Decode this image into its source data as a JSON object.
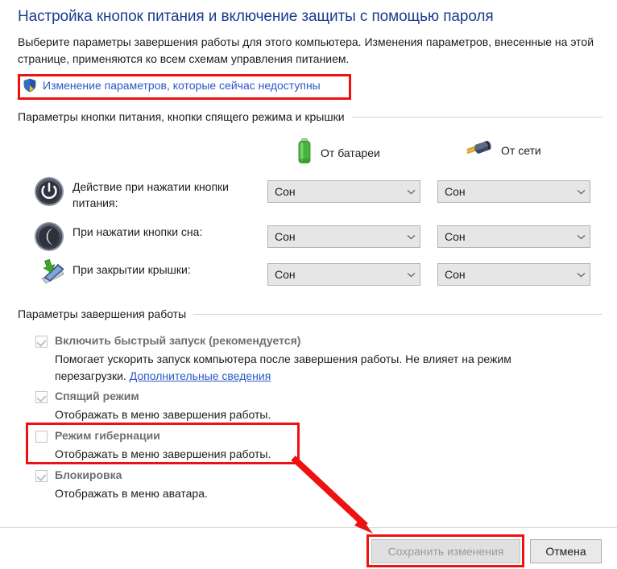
{
  "page": {
    "title": "Настройка кнопок питания и включение защиты с помощью пароля",
    "intro": "Выберите параметры завершения работы для этого компьютера. Изменения параметров, внесенные на этой странице, применяются ко всем схемам управления питанием.",
    "uac_link": "Изменение параметров, которые сейчас недоступны",
    "uac_icon": "shield-icon"
  },
  "colors": {
    "title": "#1b3d8f",
    "link": "#2a58c8",
    "annotation": "#ee1111",
    "combo_bg": "#e6e6e6",
    "battery_green": "#45b43a",
    "disabled_text": "#9a9a9a"
  },
  "power_section": {
    "header": "Параметры кнопки питания, кнопки спящего режима и крышки",
    "columns": [
      {
        "label": "От батареи",
        "icon": "battery-icon"
      },
      {
        "label": "От сети",
        "icon": "power-plug-icon"
      }
    ],
    "rows": [
      {
        "icon": "power-button-icon",
        "label": "Действие при нажатии кнопки питания:",
        "battery_value": "Сон",
        "mains_value": "Сон"
      },
      {
        "icon": "sleep-moon-icon",
        "label": "При нажатии кнопки сна:",
        "battery_value": "Сон",
        "mains_value": "Сон"
      },
      {
        "icon": "laptop-lid-icon",
        "label": "При закрытии крышки:",
        "battery_value": "Сон",
        "mains_value": "Сон"
      }
    ]
  },
  "shutdown_section": {
    "header": "Параметры завершения работы",
    "options": [
      {
        "label": "Включить быстрый запуск (рекомендуется)",
        "checked": true,
        "enabled": false,
        "description": "Помогает ускорить запуск компьютера после завершения работы. Не влияет на режим перезагрузки. ",
        "link": "Дополнительные сведения"
      },
      {
        "label": "Спящий режим",
        "checked": true,
        "enabled": false,
        "description": "Отображать в меню завершения работы.",
        "link": ""
      },
      {
        "label": "Режим гибернации",
        "checked": false,
        "enabled": false,
        "description": "Отображать в меню завершения работы.",
        "link": ""
      },
      {
        "label": "Блокировка",
        "checked": true,
        "enabled": false,
        "description": "Отображать в меню аватара.",
        "link": ""
      }
    ]
  },
  "footer": {
    "save_label": "Сохранить изменения",
    "save_enabled": false,
    "cancel_label": "Отмена"
  },
  "annotations": {
    "boxes": [
      {
        "name": "uac-link-highlight"
      },
      {
        "name": "hibernate-option-highlight"
      },
      {
        "name": "save-button-highlight"
      }
    ],
    "arrow": {
      "name": "hibernate-to-save-arrow",
      "from": "hibernate-option",
      "to": "save-button"
    }
  }
}
